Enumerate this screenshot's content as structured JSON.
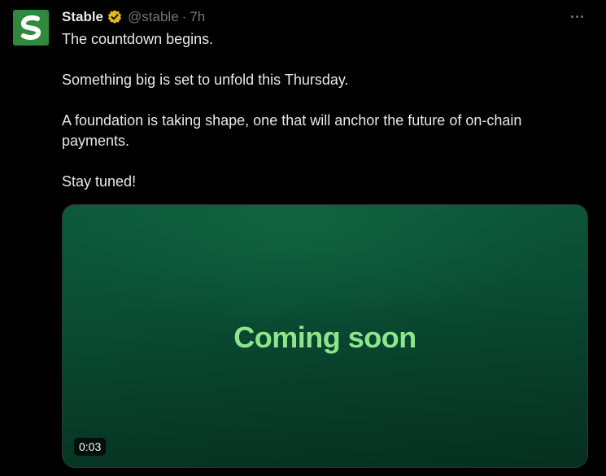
{
  "post": {
    "author_name": "Stable",
    "handle": "@stable",
    "separator": "·",
    "time": "7h",
    "paragraphs": [
      "The countdown begins.",
      "Something big is set to unfold this Thursday.",
      "A foundation is taking shape, one that will anchor the future of on-chain payments.",
      "Stay tuned!"
    ],
    "media": {
      "headline": "Coming soon",
      "duration": "0:03"
    }
  },
  "icons": {
    "avatar": "stable-logo-icon",
    "verified": "verified-badge-icon",
    "more": "more-options-icon"
  },
  "colors": {
    "background": "#000000",
    "text": "#e7e9ea",
    "muted": "#71767b",
    "verified_gold": "#e2b719",
    "avatar_green": "#2f8a3e",
    "media_text": "#8ee58b"
  }
}
